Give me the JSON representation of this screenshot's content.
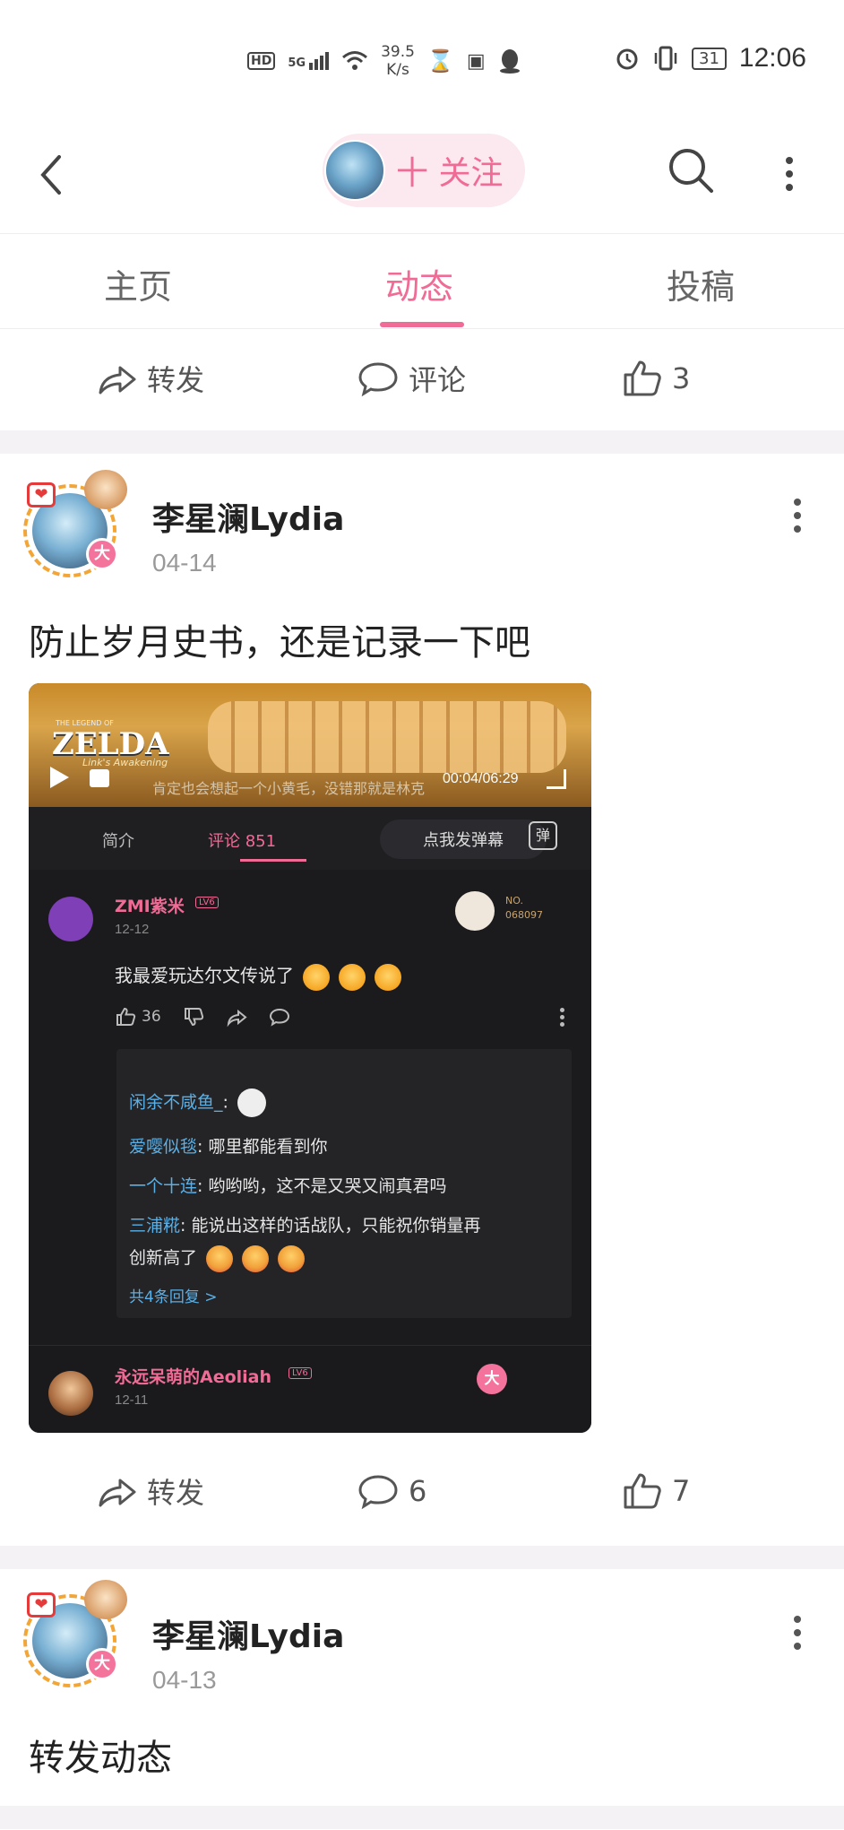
{
  "status_bar": {
    "hd": "HD",
    "network": "5G",
    "speed_value": "39.5",
    "speed_unit": "K/s",
    "battery": "31",
    "time": "12:06"
  },
  "header": {
    "follow_label": "十 关注"
  },
  "tabs": [
    {
      "label": "主页"
    },
    {
      "label": "动态"
    },
    {
      "label": "投稿"
    }
  ],
  "prev_post_actions": {
    "forward": "转发",
    "comment": "评论",
    "like": "3"
  },
  "posts": [
    {
      "author": "李星澜Lydia",
      "date": "04-14",
      "text": "防止岁月史书，还是记录一下吧",
      "vip_badge": "大",
      "forward": "转发",
      "comments": "6",
      "likes": "7",
      "screenshot": {
        "game_title": "ZELDA",
        "game_subtitle": "THE LEGEND OF",
        "game_sub2": "Link's Awakening",
        "subtitle_line": "肯定也会想起一个小黄毛，没错那就是林克",
        "video_time": "00:04/06:29",
        "tab_intro": "简介",
        "tab_comments": "评论 851",
        "danmaku_button": "点我发弹幕",
        "danmaku_icon": "弹",
        "comment1": {
          "name": "ZMI紫米",
          "level": "LV6",
          "date": "12-12",
          "text": "我最爱玩达尔文传说了",
          "likes": "36",
          "badge_no": "NO.",
          "badge_num": "068097"
        },
        "replies": [
          {
            "name": "闲余不咸鱼_",
            "text": ":"
          },
          {
            "name": "爱嘤似毯",
            "text": ": 哪里都能看到你"
          },
          {
            "name": "一个十连",
            "text": ": 哟哟哟，这不是又哭又闹真君吗"
          },
          {
            "name": "三浦糀",
            "text": ": 能说出这样的话战队，只能祝你销量再"
          },
          {
            "name": "",
            "text": "创新高了"
          }
        ],
        "more_replies": "共4条回复 >",
        "comment2": {
          "name": "永远呆萌的Aeoliah",
          "level": "LV6",
          "date": "12-11",
          "badge": "大"
        }
      }
    },
    {
      "author": "李星澜Lydia",
      "date": "04-13",
      "text": "转发动态",
      "vip_badge": "大"
    }
  ],
  "colors": {
    "accent": "#f06b95",
    "gap": "#f4f2f5"
  }
}
